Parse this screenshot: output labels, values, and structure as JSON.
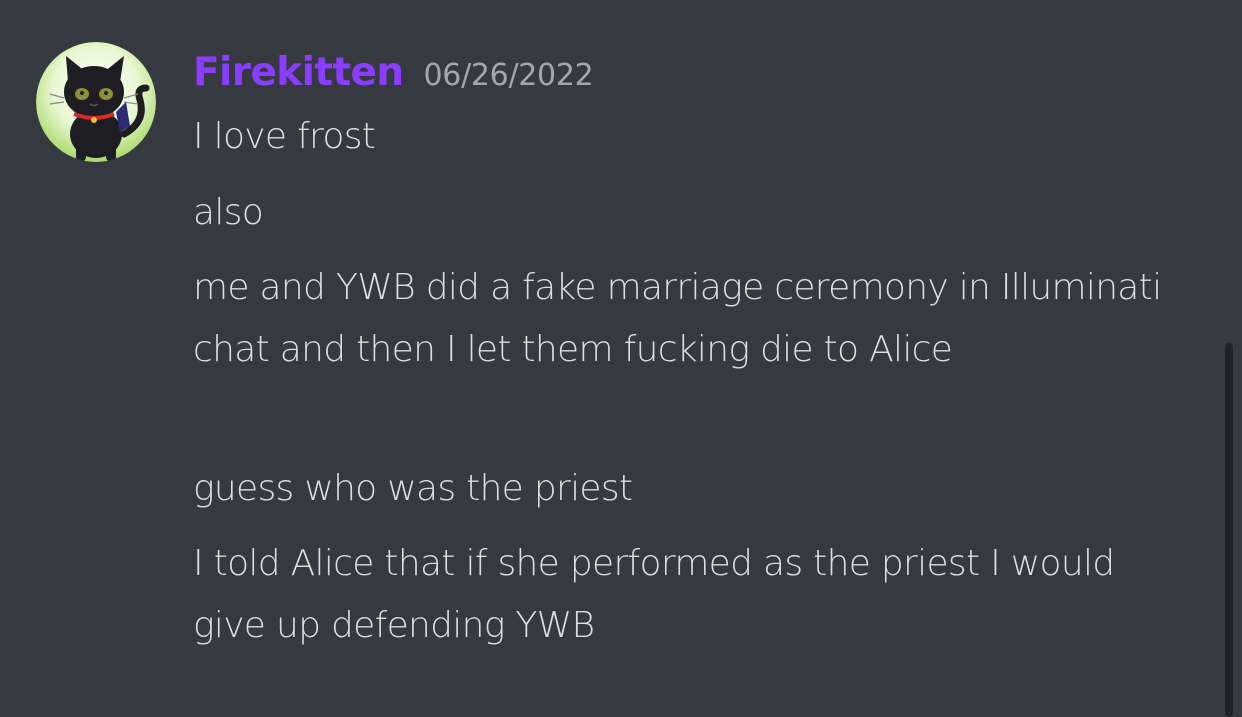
{
  "message": {
    "author": {
      "name": "Firekitten",
      "name_color": "#8a3dff",
      "avatar_icon": "black-cat-avatar-icon"
    },
    "timestamp": "06/26/2022",
    "lines": [
      "I love frost",
      "also",
      "me and YWB did a fake marriage ceremony in Illuminati chat and then I let them fucking die to Alice",
      "guess who was the priest",
      "I told Alice that if she performed as the priest I would give up defending YWB"
    ]
  },
  "colors": {
    "background": "#36393f",
    "text": "#dcddde",
    "timestamp": "#a3a6aa",
    "scrollbar": "#202225"
  }
}
